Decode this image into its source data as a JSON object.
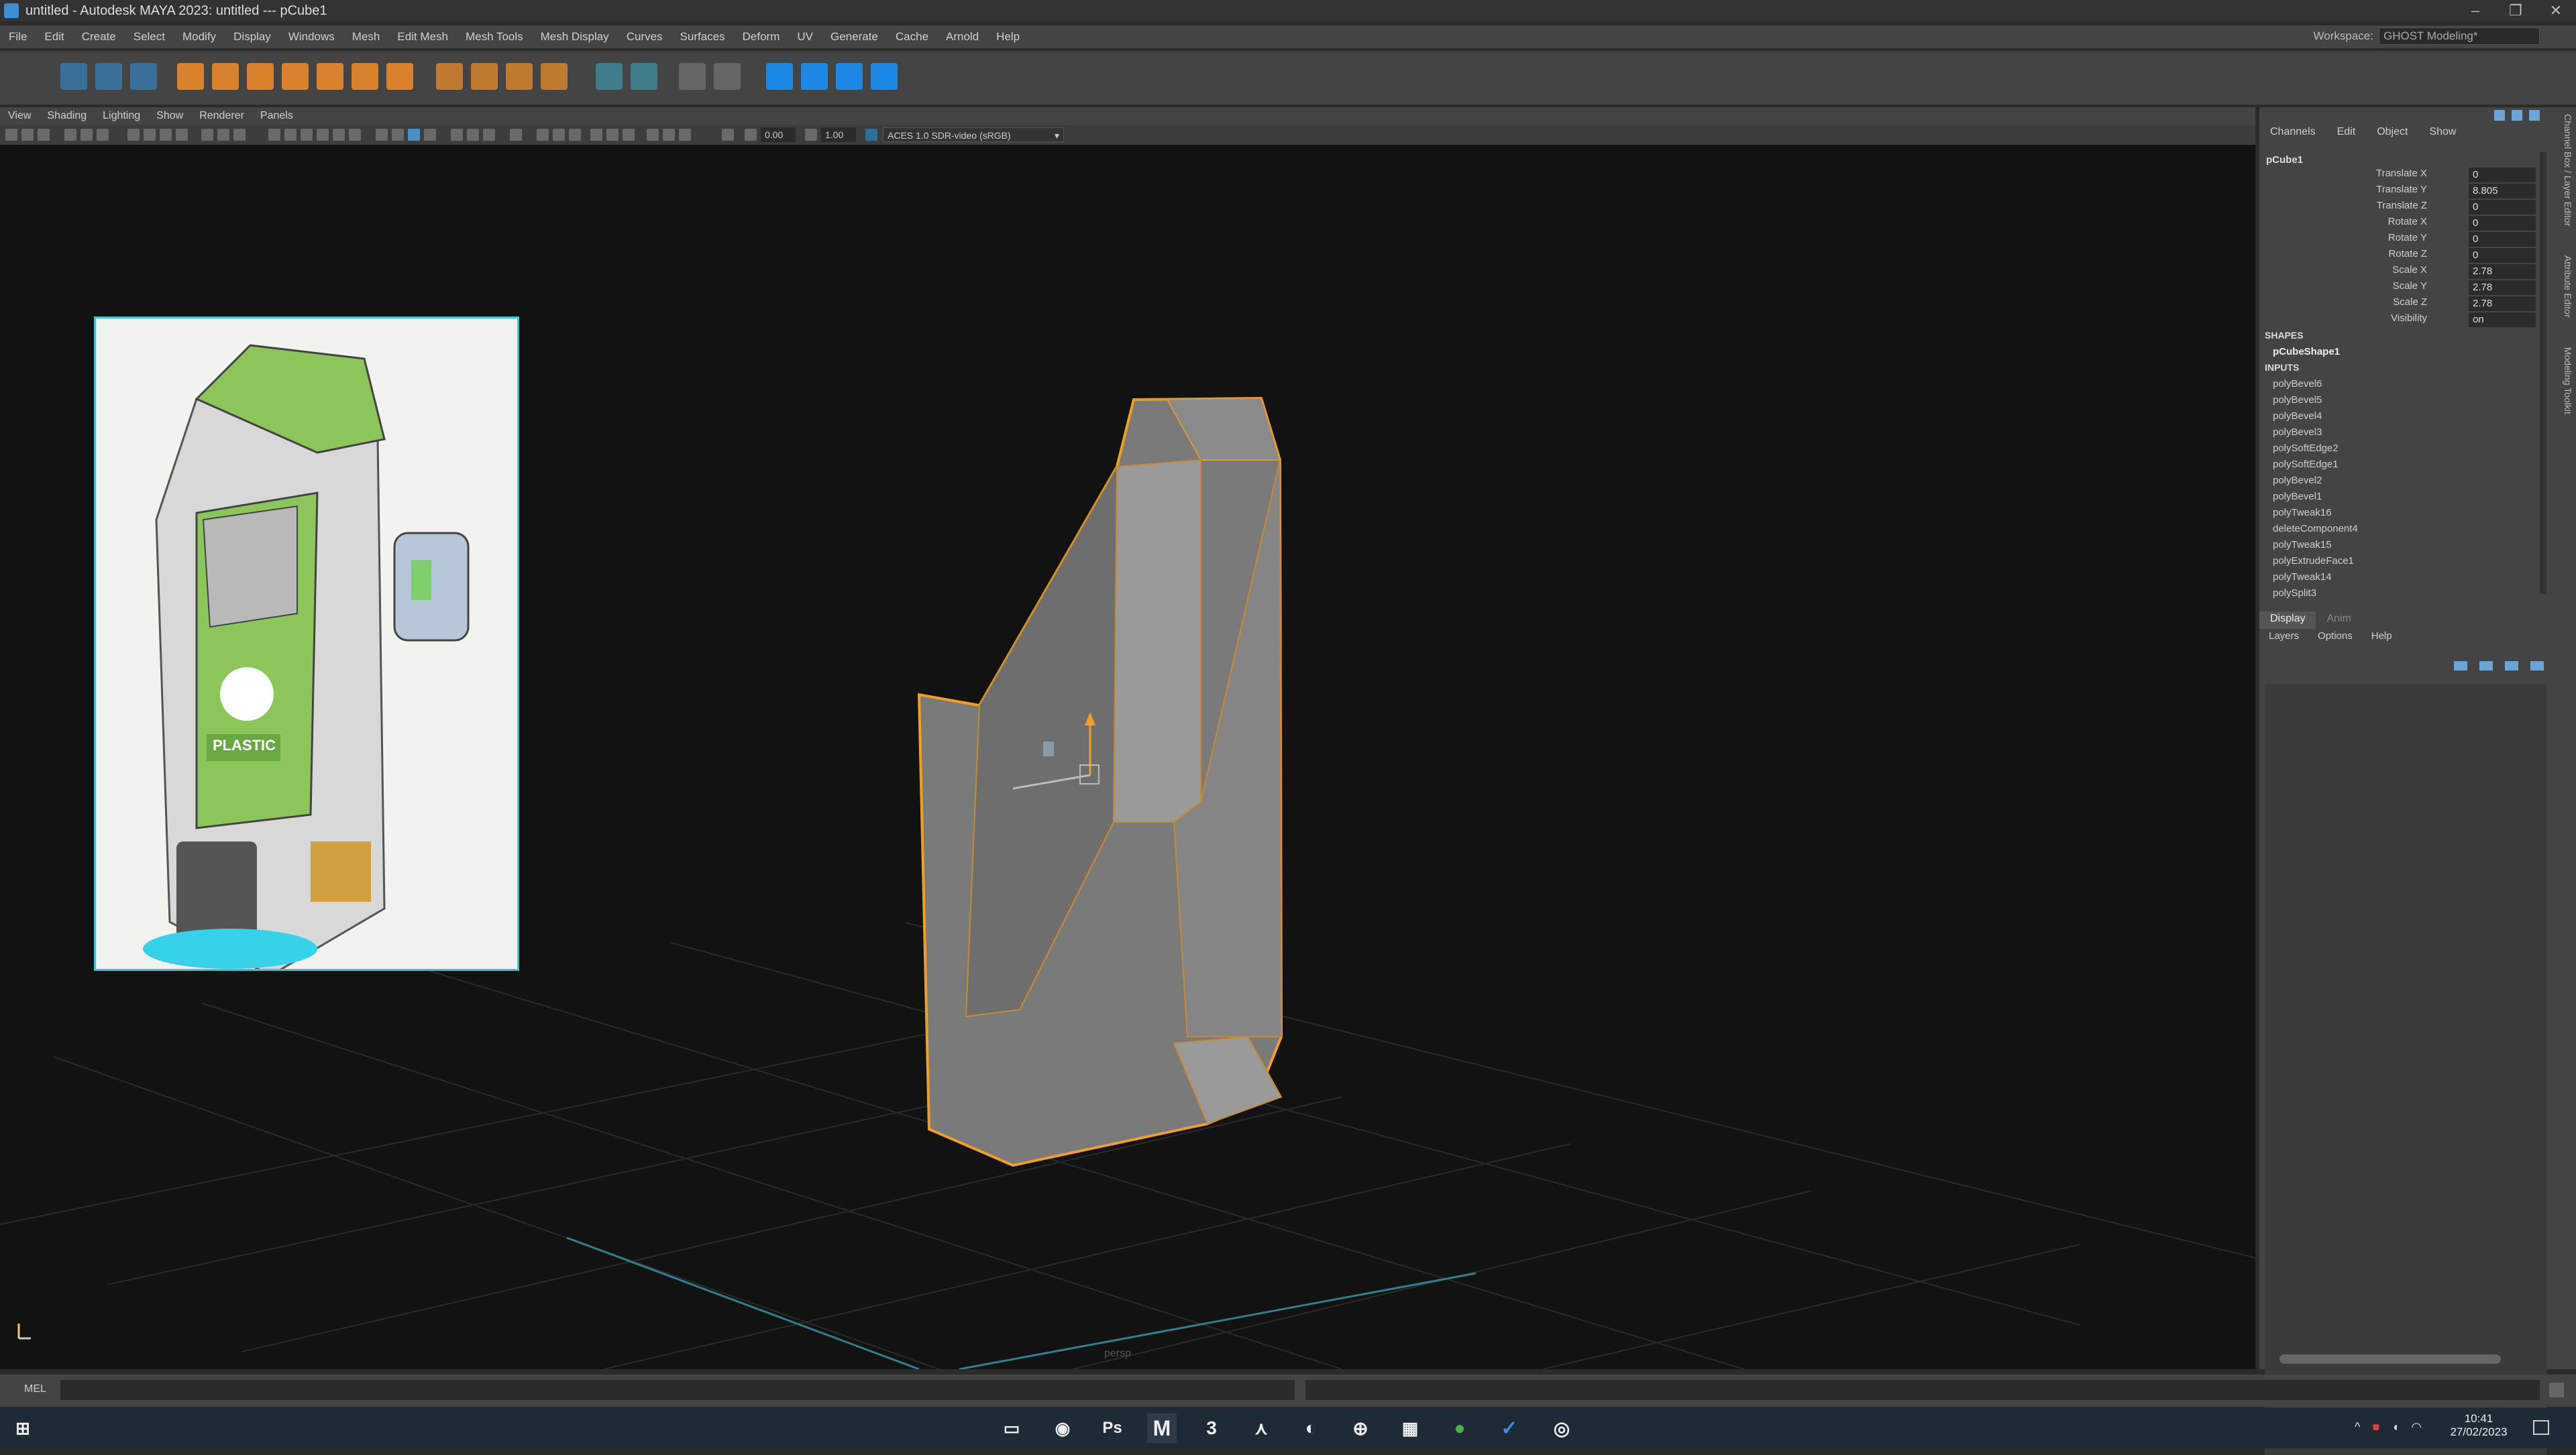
{
  "window": {
    "title": "untitled - Autodesk MAYA 2023: untitled   ---   pCube1",
    "minimize": "–",
    "restore": "❐",
    "close": "✕"
  },
  "menu": [
    "File",
    "Edit",
    "Create",
    "Select",
    "Modify",
    "Display",
    "Windows",
    "Mesh",
    "Edit Mesh",
    "Mesh Tools",
    "Mesh Display",
    "Curves",
    "Surfaces",
    "Deform",
    "UV",
    "Generate",
    "Cache",
    "Arnold",
    "Help"
  ],
  "workspace": {
    "label": "Workspace:",
    "value": "GHOST Modeling*"
  },
  "viewport": {
    "menu": [
      "View",
      "Shading",
      "Lighting",
      "Show",
      "Renderer",
      "Panels"
    ],
    "exposure": "0.00",
    "gamma": "1.00",
    "colorspace": "ACES 1.0 SDR-video (sRGB)",
    "camera_label": "persp",
    "reference_image_text": "PLASTIC"
  },
  "channel_box": {
    "tabs": [
      "Channels",
      "Edit",
      "Object",
      "Show"
    ],
    "object": "pCube1",
    "attributes": [
      {
        "label": "Translate X",
        "value": "0"
      },
      {
        "label": "Translate Y",
        "value": "8.805"
      },
      {
        "label": "Translate Z",
        "value": "0"
      },
      {
        "label": "Rotate X",
        "value": "0"
      },
      {
        "label": "Rotate Y",
        "value": "0"
      },
      {
        "label": "Rotate Z",
        "value": "0"
      },
      {
        "label": "Scale X",
        "value": "2.78"
      },
      {
        "label": "Scale Y",
        "value": "2.78"
      },
      {
        "label": "Scale Z",
        "value": "2.78"
      },
      {
        "label": "Visibility",
        "value": "on"
      }
    ],
    "shapes_header": "SHAPES",
    "shape": "pCubeShape1",
    "inputs_header": "INPUTS",
    "inputs": [
      "polyBevel6",
      "polyBevel5",
      "polyBevel4",
      "polyBevel3",
      "polySoftEdge2",
      "polySoftEdge1",
      "polyBevel2",
      "polyBevel1",
      "polyTweak16",
      "deleteComponent4",
      "polyTweak15",
      "polyExtrudeFace1",
      "polyTweak14",
      "polySplit3"
    ],
    "side_tabs": [
      "Channel Box / Layer Editor",
      "Attribute Editor",
      "Modeling Toolkit"
    ]
  },
  "layer_editor": {
    "tabs": [
      "Display",
      "Anim"
    ],
    "menu": [
      "Layers",
      "Options",
      "Help"
    ]
  },
  "command_line": {
    "label": "MEL"
  },
  "taskbar": {
    "time": "10:41",
    "date": "27/02/2023",
    "apps": [
      "monitor-icon",
      "chrome-icon",
      "Ps",
      "M",
      "3",
      "inkscape-icon",
      "contrast-icon",
      "globe-icon",
      "calendar-icon",
      "evernote-icon",
      "check-icon",
      "obs-icon"
    ]
  }
}
